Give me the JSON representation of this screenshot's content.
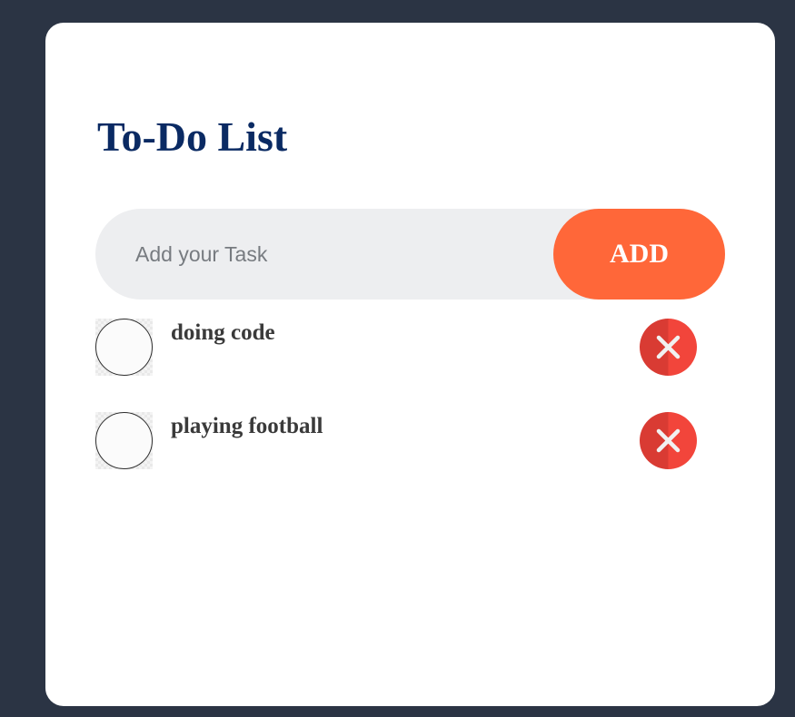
{
  "app": {
    "title": "To-Do List"
  },
  "input": {
    "placeholder": "Add your Task",
    "value": ""
  },
  "add_button": {
    "label": "ADD"
  },
  "tasks": [
    {
      "text": "doing code",
      "checked": false
    },
    {
      "text": "playing football",
      "checked": false
    }
  ],
  "icons": {
    "delete": "close-icon"
  },
  "colors": {
    "background": "#2b3444",
    "card": "#ffffff",
    "title": "#0a2a63",
    "accent": "#ff6739",
    "delete": "#e8413a",
    "input_bg": "#edeef0"
  }
}
